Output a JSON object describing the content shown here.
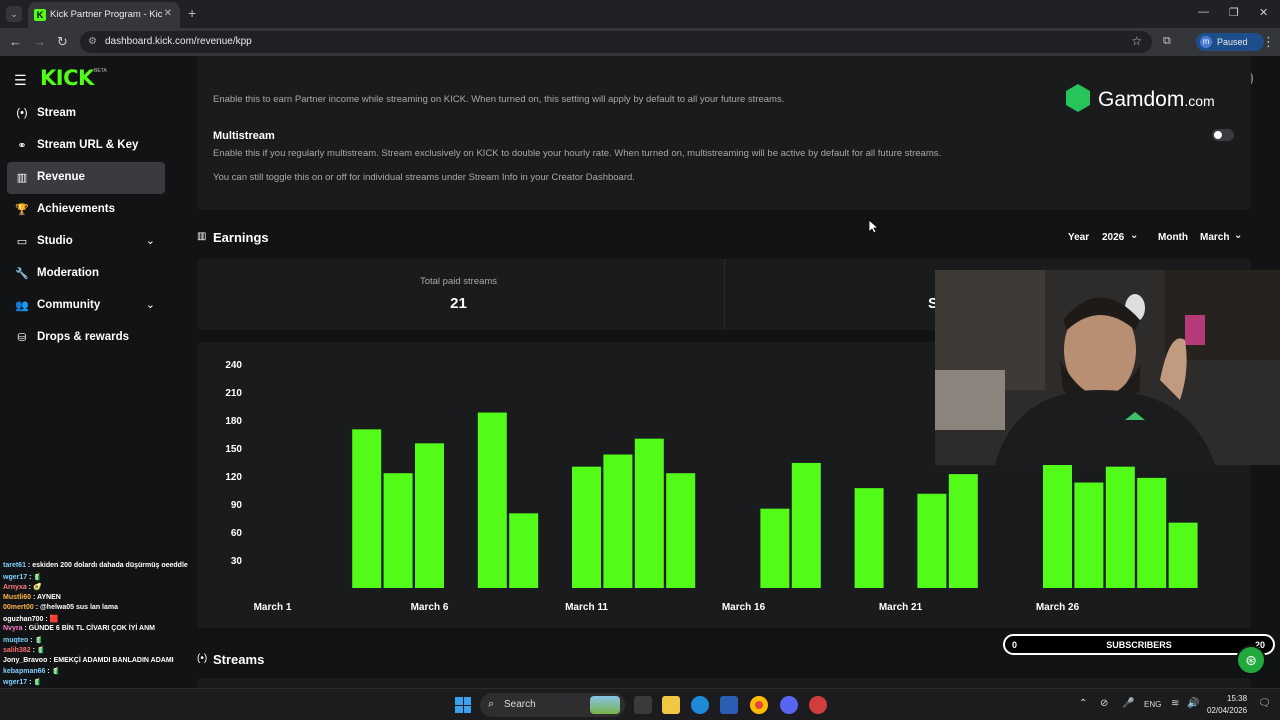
{
  "browser": {
    "tab_title": "Kick Partner Program - Kick Dashboard",
    "url": "dashboard.kick.com/revenue/kpp",
    "profile_label": "Paused",
    "profile_initial": "m"
  },
  "app": {
    "logo": "KICK",
    "logo_tag": "BETA"
  },
  "sidebar": {
    "items": [
      {
        "label": "Stream",
        "icon": "broadcast-icon",
        "glyph": "(•)"
      },
      {
        "label": "Stream URL & Key",
        "icon": "link-icon",
        "glyph": "⚭"
      },
      {
        "label": "Revenue",
        "icon": "bar-chart-icon",
        "glyph": "▥"
      },
      {
        "label": "Achievements",
        "icon": "trophy-icon",
        "glyph": "🏆"
      },
      {
        "label": "Studio",
        "icon": "studio-icon",
        "glyph": "▭"
      },
      {
        "label": "Moderation",
        "icon": "wrench-icon",
        "glyph": "🔧"
      },
      {
        "label": "Community",
        "icon": "people-icon",
        "glyph": "👥"
      },
      {
        "label": "Drops & rewards",
        "icon": "rewards-icon",
        "glyph": "⛁"
      }
    ]
  },
  "settings": {
    "partner_text": "Enable this to earn Partner income while streaming on KICK. When turned on, this setting will apply by default to all your future streams.",
    "multistream_title": "Multistream",
    "multistream_text": "Enable this if you regularly multistream. Stream exclusively on KICK to double your hourly rate. When turned on, multistreaming will be active by default for all future streams.",
    "multistream_note": "You can still toggle this on or off for individual streams under Stream Info in your Creator Dashboard.",
    "multistream_enabled": false
  },
  "earnings": {
    "title": "Earnings",
    "year_label": "Year",
    "year_value": "2026",
    "month_label": "Month",
    "month_value": "March",
    "stat_label": "Total paid streams",
    "stat_value": "21",
    "second_stat_partial": "S"
  },
  "streams": {
    "title": "Streams"
  },
  "chart_data": {
    "type": "bar",
    "title": "",
    "xlabel": "",
    "ylabel": "",
    "ylim": [
      0,
      240
    ],
    "yticks": [
      30,
      60,
      90,
      120,
      150,
      180,
      210,
      240
    ],
    "xtick_labels": [
      "March 1",
      "March 6",
      "March 11",
      "March 16",
      "March 21",
      "March 26"
    ],
    "xtick_days": [
      1,
      6,
      11,
      16,
      21,
      26
    ],
    "days": [
      1,
      2,
      3,
      4,
      5,
      6,
      7,
      8,
      9,
      10,
      11,
      12,
      13,
      14,
      15,
      16,
      17,
      18,
      19,
      20,
      21,
      22,
      23,
      24,
      25,
      26,
      27,
      28,
      29,
      30,
      31
    ],
    "values": [
      0,
      0,
      0,
      170,
      123,
      155,
      0,
      188,
      80,
      0,
      130,
      143,
      160,
      123,
      0,
      0,
      85,
      134,
      0,
      107,
      0,
      101,
      122,
      0,
      0,
      135,
      113,
      130,
      118,
      70,
      0
    ],
    "color": "#53fc18"
  },
  "overlays": {
    "sponsor": "Gamdom",
    "sponsor_suffix": ".com",
    "subscribers_left": "0",
    "subscribers_label": "SUBSCRIBERS",
    "subscribers_right": "20"
  },
  "chat": [
    {
      "user": "taret61",
      "color": "#7fd0ff",
      "text": ": eskiden 200 dolardı dahada düşürmüş oeeddle"
    },
    {
      "user": "wger17",
      "color": "#7fd0ff",
      "text": ": 🧃"
    },
    {
      "user": "Arnyxa",
      "color": "#ff7f7f",
      "text": ": 🥑"
    },
    {
      "user": "Mustli60",
      "color": "#ffb347",
      "text": ": AYNEN"
    },
    {
      "user": "00mert00",
      "color": "#ffb347",
      "text": ": @helwa05 sus lan lama"
    },
    {
      "user": "oguzhan700",
      "color": "#ffffff",
      "text": ": 🟥"
    },
    {
      "user": "Nvyra",
      "color": "#ff7fd0",
      "text": ": GÜNDE 6 BİN TL CİVARI ÇOK İYİ ANM"
    },
    {
      "user": "muqteo",
      "color": "#7fd0ff",
      "text": ": 🧃"
    },
    {
      "user": "salih382",
      "color": "#ff6f6f",
      "text": ": 🧃"
    },
    {
      "user": "Jony_Bravoo",
      "color": "#ffffff",
      "text": ": EMEKÇİ ADAMDI BANLADIN ADAMI"
    },
    {
      "user": "kebapman66",
      "color": "#7fd0ff",
      "text": ": 🧃"
    },
    {
      "user": "wger17",
      "color": "#7fd0ff",
      "text": ": 🧃"
    }
  ],
  "taskbar": {
    "search_placeholder": "Search",
    "language": "ENG",
    "time": "15:38",
    "date": "02/04/2026"
  }
}
